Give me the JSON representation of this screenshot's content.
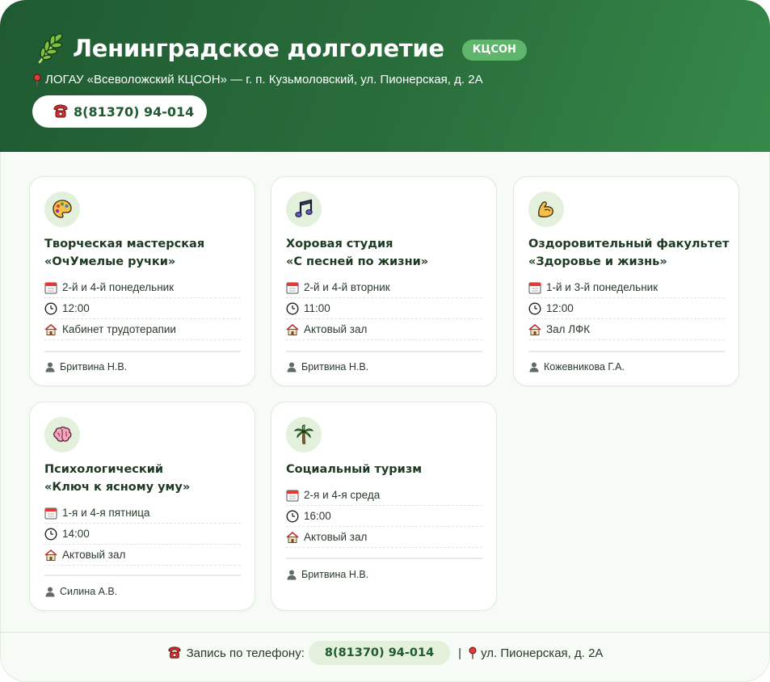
{
  "header": {
    "title": "Ленинградское долголетие",
    "badge": "КЦСОН",
    "address": "ЛОГАУ «Всеволожский КЦСОН» — г. п. Кузьмоловский, ул. Пионерская, д. 2А",
    "phone": "8(81370) 94-014",
    "icons": [
      "laurel-icon",
      "pin-icon",
      "phone-icon"
    ]
  },
  "cards": [
    {
      "icon": "palette-icon",
      "title_line1": "Творческая мастерская",
      "title_line2": "«ОчУмелые ручки»",
      "schedule": "2-й и 4-й понедельник",
      "time": "12:00",
      "place": "Кабинет трудотерапии",
      "leader": "Бритвина Н.В."
    },
    {
      "icon": "music-note-icon",
      "title_line1": "Хоровая студия",
      "title_line2": "«С песней по жизни»",
      "schedule": "2-й и 4-й вторник",
      "time": "11:00",
      "place": "Актовый зал",
      "leader": "Бритвина Н.В."
    },
    {
      "icon": "flexed-arm-icon",
      "title_line1": "Оздоровительный факультет",
      "title_line2": "«Здоровье и жизнь»",
      "schedule": "1-й и 3-й понедельник",
      "time": "12:00",
      "place": "Зал ЛФК",
      "leader": "Кожевникова Г.А."
    },
    {
      "icon": "brain-icon",
      "title_line1": "Психологический",
      "title_line2": "«Ключ к ясному уму»",
      "schedule": "1-я и 4-я пятница",
      "time": "14:00",
      "place": "Актовый зал",
      "leader": "Силина А.В."
    },
    {
      "icon": "palm-tree-icon",
      "title_line1": "Социальный туризм",
      "title_line2": "",
      "schedule": "2-я и 4-я среда",
      "time": "16:00",
      "place": "Актовый зал",
      "leader": "Бритвина Н.В."
    }
  ],
  "footer": {
    "label": "Запись по телефону:",
    "phone": "8(81370) 94-014",
    "separator": "|",
    "address": "ул. Пионерская, д. 2А"
  },
  "colors": {
    "header_dark": "#1f5a32",
    "header_light": "#36894a",
    "badge": "#5fb56c",
    "icon_bg": "#e3f0dc",
    "page_bg": "#f6fbf5"
  }
}
